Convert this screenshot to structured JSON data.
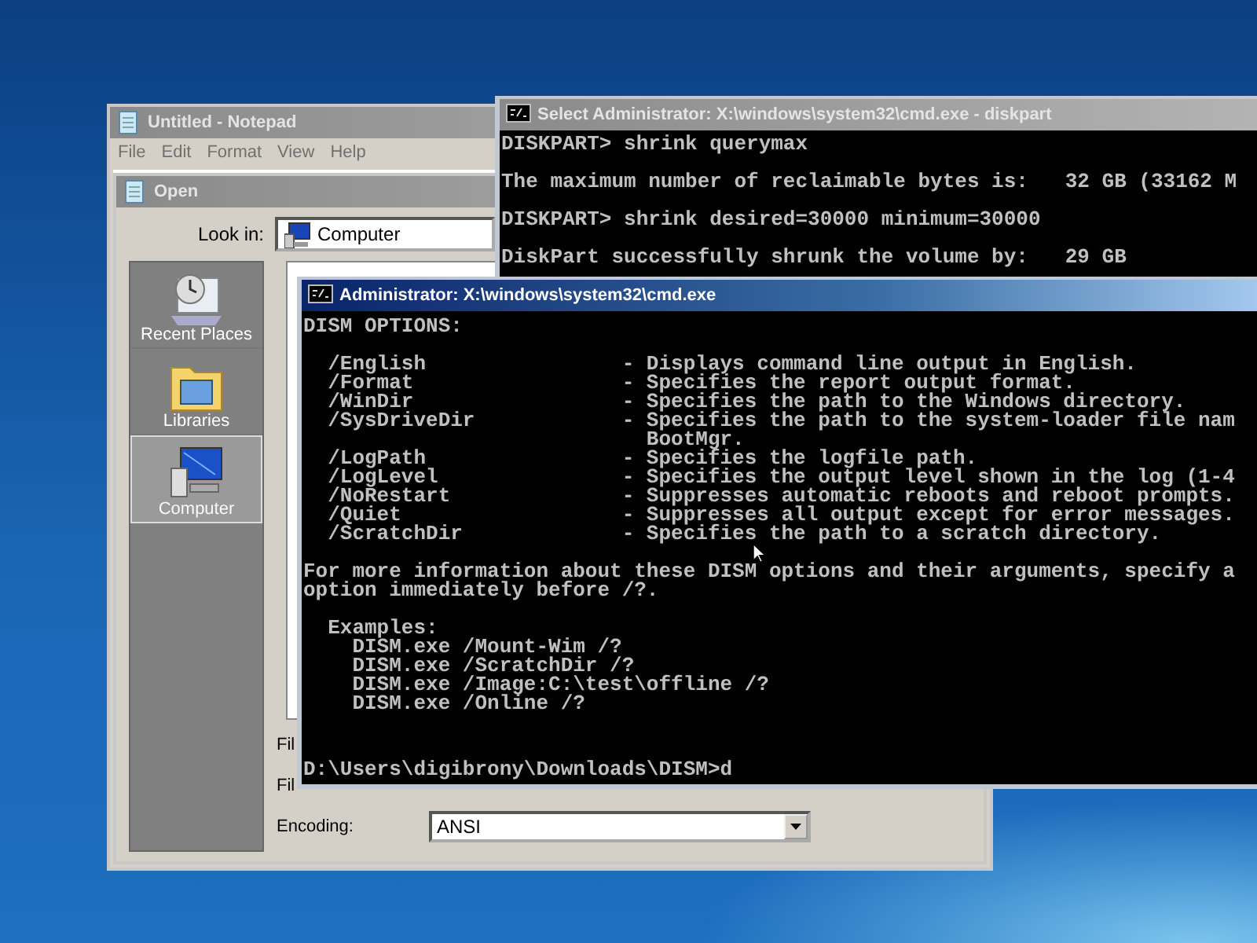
{
  "notepad": {
    "title": "Untitled - Notepad",
    "active": false,
    "menu": [
      "File",
      "Edit",
      "Format",
      "View",
      "Help"
    ],
    "open_dialog": {
      "title": "Open",
      "active": false,
      "look_in_label": "Look in:",
      "look_in_value": "Computer",
      "places": [
        {
          "label": "Recent Places",
          "kind": "recent",
          "selected": false
        },
        {
          "label": "Libraries",
          "kind": "libraries",
          "selected": false
        },
        {
          "label": "Computer",
          "kind": "computer",
          "selected": true
        }
      ],
      "field_labels": [
        "Fil",
        "Fil"
      ],
      "encoding_label": "Encoding:",
      "encoding_value": "ANSI"
    }
  },
  "diskpart_window": {
    "title": "Select Administrator: X:\\windows\\system32\\cmd.exe - diskpart",
    "active": false,
    "blocks": [
      [
        "DISKPART> shrink querymax"
      ],
      [
        "The maximum number of reclaimable bytes is:   32 GB (33162 M"
      ],
      [
        "DISKPART> shrink desired=30000 minimum=30000"
      ],
      [
        "DiskPart successfully shrunk the volume by:   29 GB"
      ]
    ]
  },
  "dism_window": {
    "title": "Administrator: X:\\windows\\system32\\cmd.exe",
    "active": true,
    "blocks": [
      [
        "DISM OPTIONS:"
      ],
      [
        "  /English                - Displays command line output in English.",
        "  /Format                 - Specifies the report output format.",
        "  /WinDir                 - Specifies the path to the Windows directory.",
        "  /SysDriveDir            - Specifies the path to the system-loader file nam",
        "                            BootMgr.",
        "  /LogPath                - Specifies the logfile path.",
        "  /LogLevel               - Specifies the output level shown in the log (1-4",
        "  /NoRestart              - Suppresses automatic reboots and reboot prompts.",
        "  /Quiet                  - Suppresses all output except for error messages.",
        "  /ScratchDir             - Specifies the path to a scratch directory."
      ],
      [
        "For more information about these DISM options and their arguments, specify a",
        "option immediately before /?."
      ],
      [
        "  Examples:",
        "    DISM.exe /Mount-Wim /?",
        "    DISM.exe /ScratchDir /?",
        "    DISM.exe /Image:C:\\test\\offline /?",
        "    DISM.exe /Online /?"
      ]
    ],
    "prompt": "D:\\Users\\digibrony\\Downloads\\DISM>d"
  }
}
